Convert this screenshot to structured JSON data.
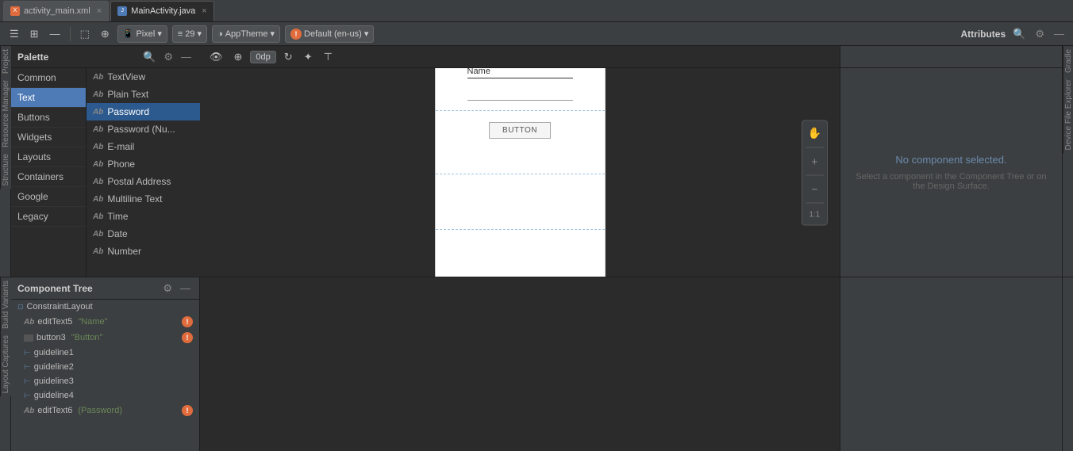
{
  "tabs": [
    {
      "id": "activity_main_xml",
      "label": "activity_main.xml",
      "icon": "xml",
      "active": false
    },
    {
      "id": "main_activity_java",
      "label": "MainActivity.java",
      "icon": "java",
      "active": true
    }
  ],
  "toolbar": {
    "pixel_label": "Pixel",
    "api_label": "29",
    "theme_label": "AppTheme",
    "locale_label": "Default (en-us)",
    "attrs_label": "Attributes"
  },
  "palette": {
    "title": "Palette",
    "categories": [
      {
        "id": "common",
        "label": "Common",
        "active": false
      },
      {
        "id": "text",
        "label": "Text",
        "active": true
      },
      {
        "id": "buttons",
        "label": "Buttons",
        "active": false
      },
      {
        "id": "widgets",
        "label": "Widgets",
        "active": false
      },
      {
        "id": "layouts",
        "label": "Layouts",
        "active": false
      },
      {
        "id": "containers",
        "label": "Containers",
        "active": false
      },
      {
        "id": "google",
        "label": "Google",
        "active": false
      },
      {
        "id": "legacy",
        "label": "Legacy",
        "active": false
      }
    ],
    "items": [
      {
        "id": "textview",
        "label": "TextView",
        "icon": "Ab"
      },
      {
        "id": "plain_text",
        "label": "Plain Text",
        "icon": "Ab"
      },
      {
        "id": "password",
        "label": "Password",
        "icon": "Ab",
        "selected": true
      },
      {
        "id": "password_num",
        "label": "Password (Nu...",
        "icon": "Ab"
      },
      {
        "id": "email",
        "label": "E-mail",
        "icon": "Ab"
      },
      {
        "id": "phone",
        "label": "Phone",
        "icon": "Ab"
      },
      {
        "id": "postal",
        "label": "Postal Address",
        "icon": "Ab"
      },
      {
        "id": "multiline",
        "label": "Multiline Text",
        "icon": "Ab"
      },
      {
        "id": "time",
        "label": "Time",
        "icon": "Ab"
      },
      {
        "id": "date",
        "label": "Date",
        "icon": "Ab"
      },
      {
        "id": "number",
        "label": "Number",
        "icon": "Ab"
      }
    ]
  },
  "design": {
    "canvas": {
      "name_text": "Name",
      "button_text": "BUTTON"
    }
  },
  "component_tree": {
    "title": "Component Tree",
    "items": [
      {
        "id": "constraint_layout",
        "label": "ConstraintLayout",
        "indent": 0,
        "icon": "layout",
        "error": false
      },
      {
        "id": "edit_text5",
        "label": "editText5",
        "id_label": "\"Name\"",
        "indent": 1,
        "icon": "ab",
        "error": true
      },
      {
        "id": "button3",
        "label": "button3",
        "id_label": "\"Button\"",
        "indent": 1,
        "icon": "btn",
        "error": true
      },
      {
        "id": "guideline1",
        "label": "guideline1",
        "indent": 1,
        "icon": "guide",
        "error": false
      },
      {
        "id": "guideline2",
        "label": "guideline2",
        "indent": 1,
        "icon": "guide",
        "error": false
      },
      {
        "id": "guideline3",
        "label": "guideline3",
        "indent": 1,
        "icon": "guide",
        "error": false
      },
      {
        "id": "guideline4",
        "label": "guideline4",
        "indent": 1,
        "icon": "guide",
        "error": false
      },
      {
        "id": "edit_text6",
        "label": "editText6",
        "id_label": "(Password)",
        "indent": 1,
        "icon": "ab",
        "error": true
      }
    ]
  },
  "attributes": {
    "title": "Attributes",
    "no_selection": "No component selected.",
    "hint": "Select a component in the Component Tree or on the Design Surface."
  },
  "side_labels": {
    "project": "Project",
    "resource_manager": "Resource Manager",
    "structure": "Structure",
    "build_variants": "Build Variants",
    "layout_captures": "Layout Captures",
    "gradle": "Gradle",
    "device_file": "Device File Explorer"
  }
}
